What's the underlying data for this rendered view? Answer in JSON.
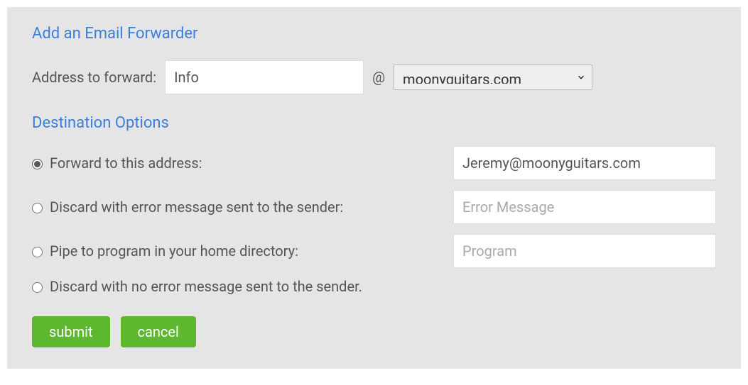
{
  "sections": {
    "add_forwarder_title": "Add an Email Forwarder",
    "destination_options_title": "Destination Options"
  },
  "address": {
    "label": "Address to forward:",
    "value": "Info",
    "at": "@",
    "domain": "moonyguitars.com"
  },
  "options": {
    "forward": {
      "label": "Forward to this address:",
      "value": "Jeremy@moonyguitars.com",
      "checked": true
    },
    "discard_error": {
      "label": "Discard with error message sent to the sender:",
      "placeholder": "Error Message",
      "checked": false
    },
    "pipe": {
      "label": "Pipe to program in your home directory:",
      "placeholder": "Program",
      "checked": false
    },
    "discard_silent": {
      "label": "Discard with no error message sent to the sender.",
      "checked": false
    }
  },
  "buttons": {
    "submit": "submit",
    "cancel": "cancel"
  }
}
